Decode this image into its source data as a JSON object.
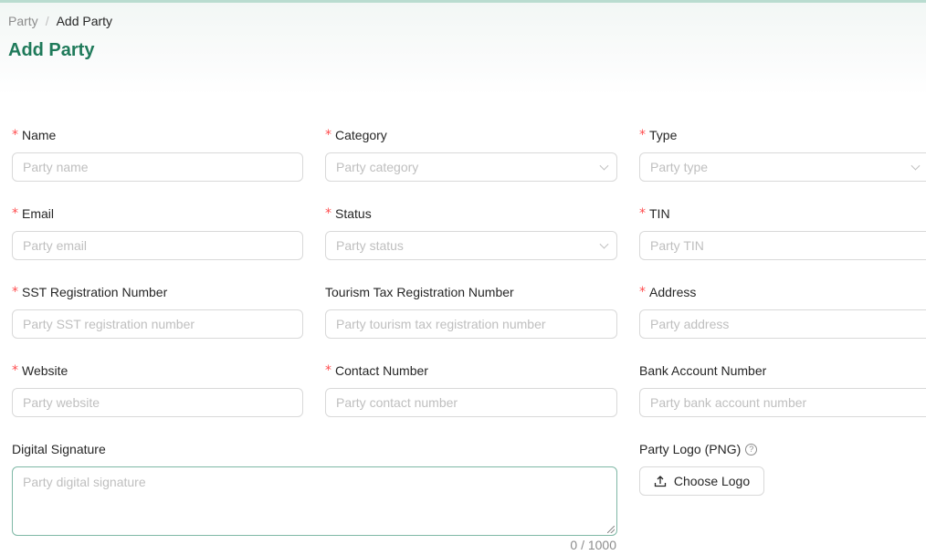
{
  "breadcrumb": {
    "parent": "Party",
    "separator": "/",
    "current": "Add Party"
  },
  "page_title": "Add Party",
  "fields": {
    "name": {
      "label": "Name",
      "placeholder": "Party name",
      "required": true
    },
    "category": {
      "label": "Category",
      "placeholder": "Party category",
      "required": true
    },
    "type": {
      "label": "Type",
      "placeholder": "Party type",
      "required": true
    },
    "email": {
      "label": "Email",
      "placeholder": "Party email",
      "required": true
    },
    "status": {
      "label": "Status",
      "placeholder": "Party status",
      "required": true
    },
    "tin": {
      "label": "TIN",
      "placeholder": "Party TIN",
      "required": true
    },
    "sst": {
      "label": "SST Registration Number",
      "placeholder": "Party SST registration number",
      "required": true
    },
    "tourism": {
      "label": "Tourism Tax Registration Number",
      "placeholder": "Party tourism tax registration number",
      "required": false
    },
    "address": {
      "label": "Address",
      "placeholder": "Party address",
      "required": true
    },
    "website": {
      "label": "Website",
      "placeholder": "Party website",
      "required": true
    },
    "contact": {
      "label": "Contact Number",
      "placeholder": "Party contact number",
      "required": true
    },
    "bank": {
      "label": "Bank Account Number",
      "placeholder": "Party bank account number",
      "required": false
    },
    "signature": {
      "label": "Digital Signature",
      "placeholder": "Party digital signature",
      "count": "0 / 1000"
    },
    "logo": {
      "label": "Party Logo (PNG)",
      "help_icon": "?",
      "button": "Choose Logo"
    }
  },
  "required_mark": "*",
  "colors": {
    "accent": "#1f7a5a",
    "required": "#ff4d4f",
    "placeholder": "#bfbfbf",
    "border": "#d9d9d9"
  }
}
